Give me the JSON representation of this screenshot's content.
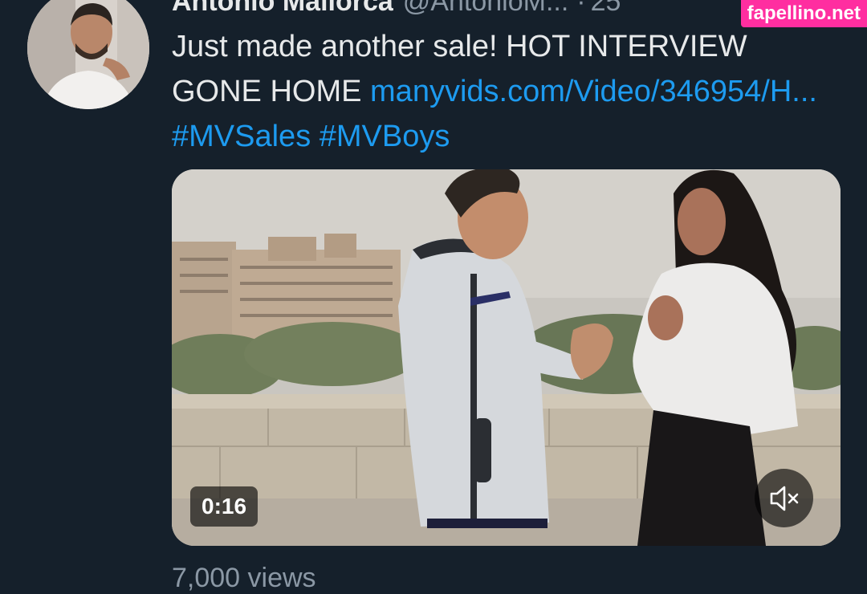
{
  "author": {
    "display_name": "Antonio Mallorca",
    "handle": "@AntonioM...",
    "separator": "·",
    "time": "25"
  },
  "tweet": {
    "text_plain": "Just made another sale! HOT INTERVIEW GONE HOME ",
    "link": "manyvids.com/Video/346954/H...",
    "hashtags": [
      "#MVSales",
      "#MVBoys"
    ]
  },
  "media": {
    "duration": "0:16",
    "mute_icon": "speaker-muted-icon"
  },
  "metrics": {
    "views_partial": "7,000 views"
  },
  "watermark": "fapellino.net",
  "colors": {
    "background": "#15202b",
    "text": "#e7e9ea",
    "secondary": "#8b98a5",
    "link": "#1d9bf0",
    "watermark_bg": "#ff2ea0"
  }
}
